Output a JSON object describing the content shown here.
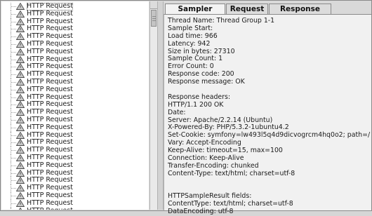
{
  "tree": {
    "items": [
      {
        "label": "HTTP Request",
        "selected": true
      },
      {
        "label": "HTTP Request"
      },
      {
        "label": "HTTP Request"
      },
      {
        "label": "HTTP Request"
      },
      {
        "label": "HTTP Request"
      },
      {
        "label": "HTTP Request"
      },
      {
        "label": "HTTP Request"
      },
      {
        "label": "HTTP Request"
      },
      {
        "label": "HTTP Request"
      },
      {
        "label": "HTTP Request"
      },
      {
        "label": "HTTP Request"
      },
      {
        "label": "HTTP Request"
      },
      {
        "label": "HTTP Request"
      },
      {
        "label": "HTTP Request"
      },
      {
        "label": "HTTP Request"
      },
      {
        "label": "HTTP Request"
      },
      {
        "label": "HTTP Request"
      },
      {
        "label": "HTTP Request"
      },
      {
        "label": "HTTP Request"
      },
      {
        "label": "HTTP Request"
      },
      {
        "label": "HTTP Request"
      },
      {
        "label": "HTTP Request"
      },
      {
        "label": "HTTP Request"
      },
      {
        "label": "HTTP Request"
      },
      {
        "label": "HTTP Request"
      },
      {
        "label": "HTTP Request"
      },
      {
        "label": "HTTP Request"
      },
      {
        "label": "HTTP Request"
      }
    ],
    "item_icon": "warning-icon"
  },
  "tabs": [
    {
      "label": "Sampler result",
      "active": true
    },
    {
      "label": "Request",
      "active": false
    },
    {
      "label": "Response data",
      "active": false
    }
  ],
  "sampler_result": {
    "lines": [
      "Thread Name: Thread Group 1-1",
      "Sample Start:",
      "Load time: 966",
      "Latency: 942",
      "Size in bytes: 27310",
      "Sample Count: 1",
      "Error Count: 0",
      "Response code: 200",
      "Response message: OK",
      "",
      "Response headers:",
      "HTTP/1.1 200 OK",
      "Date:",
      "Server: Apache/2.2.14 (Ubuntu)",
      "X-Powered-By: PHP/5.3.2-1ubuntu4.2",
      "Set-Cookie: symfony=lw493l5q4d9dicvogrcm4hq0o2; path=/",
      "Vary: Accept-Encoding",
      "Keep-Alive: timeout=15, max=100",
      "Connection: Keep-Alive",
      "Transfer-Encoding: chunked",
      "Content-Type: text/html; charset=utf-8",
      "",
      "",
      "HTTPSampleResult fields:",
      "ContentType: text/html; charset=utf-8",
      "DataEncoding: utf-8"
    ]
  },
  "colors": {
    "warning_icon_fill": "#c9c9c9",
    "warning_icon_stroke": "#4a4a4a"
  }
}
